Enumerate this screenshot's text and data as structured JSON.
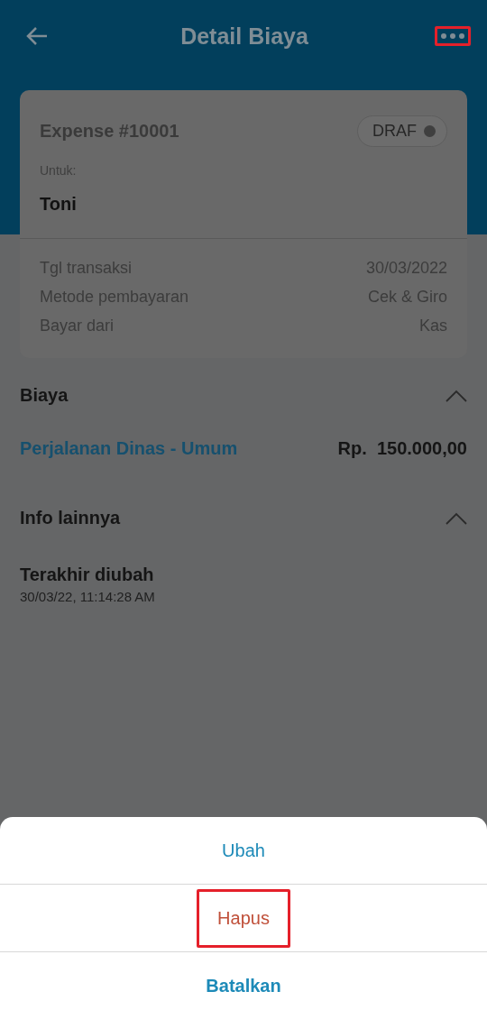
{
  "header": {
    "title": "Detail Biaya",
    "menu_highlighted": true
  },
  "summary": {
    "title": "Expense #10001",
    "status": {
      "label": "DRAF",
      "color": "#3f3f3f"
    },
    "for_label": "Untuk:",
    "for_value": "Toni",
    "details": [
      {
        "label": "Tgl transaksi",
        "value": "30/03/2022"
      },
      {
        "label": "Metode pembayaran",
        "value": "Cek & Giro"
      },
      {
        "label": "Bayar dari",
        "value": "Kas"
      }
    ]
  },
  "sections": [
    {
      "title": "Biaya",
      "expanded": true,
      "items": [
        {
          "kind": "line",
          "name": "Perjalanan Dinas - Umum",
          "currency": "Rp.",
          "amount": "150.000,00"
        }
      ]
    },
    {
      "title": "Info lainnya",
      "expanded": true,
      "items": [
        {
          "kind": "info",
          "label": "Terakhir diubah",
          "value": "30/03/22, 11:14:28 AM"
        }
      ]
    }
  ],
  "action_sheet": {
    "actions": [
      {
        "label": "Ubah",
        "kind": "normal",
        "highlighted": false
      },
      {
        "label": "Hapus",
        "kind": "danger",
        "highlighted": true
      },
      {
        "label": "Batalkan",
        "kind": "cancel",
        "highlighted": false
      }
    ]
  }
}
